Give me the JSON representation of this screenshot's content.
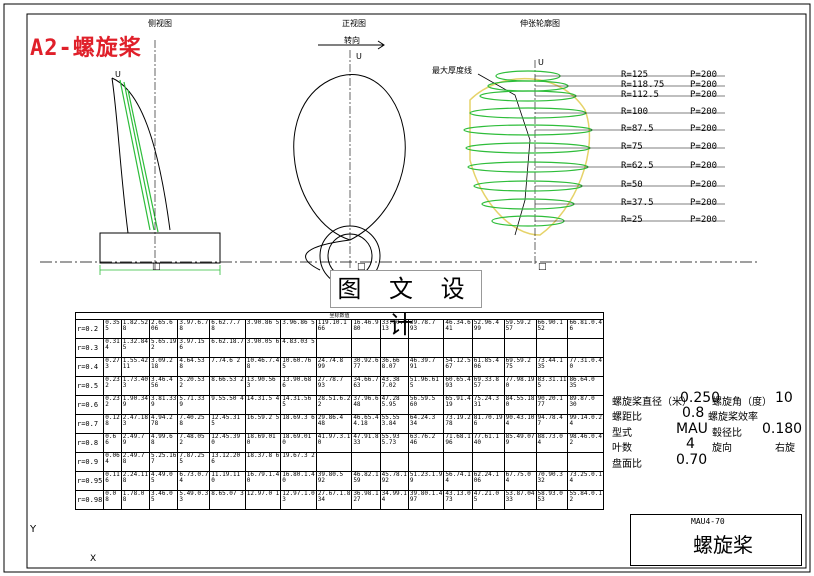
{
  "badge": "A2-螺旋桨",
  "views": {
    "side_title": "侧视图",
    "front_title": "正视图",
    "front_arrow_label": "转向",
    "expanded_title": "伸张轮廓图",
    "max_thickness_label": "最大厚度线",
    "axis_u": "U",
    "axis_hub": "□",
    "axis_y": "Y",
    "axis_x": "X"
  },
  "watermark": "图 文 设 计",
  "radius_pitch": [
    {
      "r": "R=125",
      "p": "P=200"
    },
    {
      "r": "R=118.75",
      "p": "P=200"
    },
    {
      "r": "R=112.5",
      "p": "P=200"
    },
    {
      "r": "R=100",
      "p": "P=200"
    },
    {
      "r": "R=87.5",
      "p": "P=200"
    },
    {
      "r": "R=75",
      "p": "P=200"
    },
    {
      "r": "R=62.5",
      "p": "P=200"
    },
    {
      "r": "R=50",
      "p": "P=200"
    },
    {
      "r": "R=37.5",
      "p": "P=200"
    },
    {
      "r": "R=25",
      "p": "P=200"
    }
  ],
  "table": {
    "header": "坐标数值",
    "rows": [
      {
        "label": "r=0.2",
        "cells": [
          "0.35 5",
          "1.82.52 8",
          "2.65.6 06",
          "3.97.6.7 8",
          "6.62.7.7 8",
          "3.90.86 5",
          "3.96.86 5",
          "119.10.1 66",
          "16.46.9 80",
          "33.10.9 13",
          "39.78.7 93",
          "46.34.6 41",
          "52.96.4 99",
          "59.59.2 57",
          "66.90.1 52",
          "66.81.0.4 6"
        ]
      },
      {
        "label": "r=0.3",
        "cells": [
          "0.31 4",
          "1.32.84 5",
          "5.65.19 2",
          "3.97.15 6",
          "6.62.18.7",
          "3.90.05 6",
          "4.83.03 5",
          "",
          "",
          "",
          "",
          "",
          "",
          "",
          "",
          ""
        ]
      },
      {
        "label": "r=0.4",
        "cells": [
          "0.27 3",
          "1.55.42 11",
          "3.09.2 18",
          "4.64.53 8",
          "7.74.6 2",
          "10.46.7.4 8",
          "10.60.76 5",
          "24.74.8 99",
          "30.92.6 77",
          "36.66 8.07",
          "46.39.7 91",
          "54.12.5 67",
          "61.85.4 06",
          "69.59.2 75",
          "73.44.1 35",
          "77.31.0.4 0"
        ]
      },
      {
        "label": "r=0.5",
        "cells": [
          "0.23 2",
          "1.73.40 3",
          "3.46.4 56",
          "5.20.53 2",
          "8.66.53 2",
          "13.90.56 3",
          "13.90.68 6",
          "27.78.7 93",
          "34.66.7 63",
          "43.38 7.02",
          "51.96.61 5",
          "60.65.4 93",
          "69.33.8 57",
          "77.98.19 0",
          "83.31.11 5",
          "86.64.0 35"
        ]
      },
      {
        "label": "r=0.6",
        "cells": [
          "0.23 2",
          "1.90.34 9",
          "3.81.33 9",
          "5.71.33 9",
          "9.55.50 4",
          "14.31.5 4",
          "14.31.56 5",
          "28.51.6.2 2",
          "37.96.6 48",
          "47.28 5.95",
          "56.59.5 60",
          "65.91.4 19",
          "75.24.3 31",
          "84.55.18 0",
          "90.20.1 77",
          "89.87.0 30"
        ]
      },
      {
        "label": "r=0.7",
        "cells": [
          "0.12 8",
          "2.47.18 3",
          "4.94.2 78",
          "7.40.25 8",
          "12.45.31 5",
          "16.59.2 5",
          "18.69.3 6",
          "29.86.4 48",
          "46.65.4 4.18",
          "55.55 3.84",
          "64.24.3 34",
          "73.19.2 78",
          "81.70.19 6",
          "90.43.10 4",
          "94.78.4 7",
          "99.14.0.2 4"
        ]
      },
      {
        "label": "r=0.8",
        "cells": [
          "0.6 6",
          "2.49.7 9",
          "4.99.6 8",
          "7.48.05 2",
          "12.45.39 0",
          "18.69.01 0",
          "18.69.01 0",
          "41.97.3.1 0",
          "47.91.8 33",
          "55.93 5.73",
          "63.76.2 46",
          "71.68.1 96",
          "77.61.1 40",
          "85.49.07 9",
          "88.73.0 4",
          "98.46.0.4 2"
        ]
      },
      {
        "label": "r=0.9",
        "cells": [
          "0.06 4",
          "2.49.7 8",
          "5.25.16 7",
          "7.87.25 5",
          "13.12.20 6",
          "18.37.8 6",
          "19.67.3 2",
          "",
          "",
          "",
          "",
          "",
          "",
          "",
          "",
          ""
        ]
      },
      {
        "label": "r=0.95",
        "cells": [
          "0.11 6",
          "2.24.11 8",
          "4.49.0 5",
          "6.73.0.7 4",
          "11.19.11 0",
          "16.79.1.4 0",
          "16.80.1.4 0",
          "39.80.5 92",
          "46.82.1 59",
          "45.78.1 92",
          "51.23.1.9 9",
          "56.74.1 4",
          "62.24.1 06",
          "67.75.0 4",
          "70.90.3 32",
          "73.25.0.1 4"
        ]
      },
      {
        "label": "r=0.98",
        "cells": [
          "0.0 8",
          "1.78.0 8",
          "3.46.0 5",
          "5.49.0.3 3",
          "8.65.07 3",
          "12.97.0 1",
          "12.97.1.0 3",
          "27.67.1.8 34",
          "36.98.1 27",
          "34.99.1 4",
          "39.80.1.4 97",
          "43.13.0 73",
          "47.21.0 5",
          "53.87.04 33",
          "58.93.0 53",
          "55.84.0.1 2"
        ]
      }
    ]
  },
  "params": {
    "dia_label": "螺旋桨直径（米）",
    "dia_value": "0.250",
    "blades_count_label": "螺旋角（度）",
    "blades_count_value": "10",
    "pitch_ratio_label": "螺距比",
    "pitch_ratio_value": "0.8",
    "thick_ratio_label": "螺旋桨效率",
    "type_label": "型式",
    "type_value": "MAU",
    "hub_ratio_label": "毂径比",
    "hub_ratio_value": "0.180",
    "blade_label": "叶数",
    "blade_value": "4",
    "rotation_label": "旋向",
    "rotation_value": "右旋",
    "area_label": "盘面比",
    "area_value": "0.70"
  },
  "title_block": {
    "code": "MAU4-70",
    "name": "螺旋桨"
  },
  "colors": {
    "badge": "#e0202a",
    "drawing": "#000000",
    "section": "#2ebd3a",
    "outline": "#e6d36a"
  }
}
